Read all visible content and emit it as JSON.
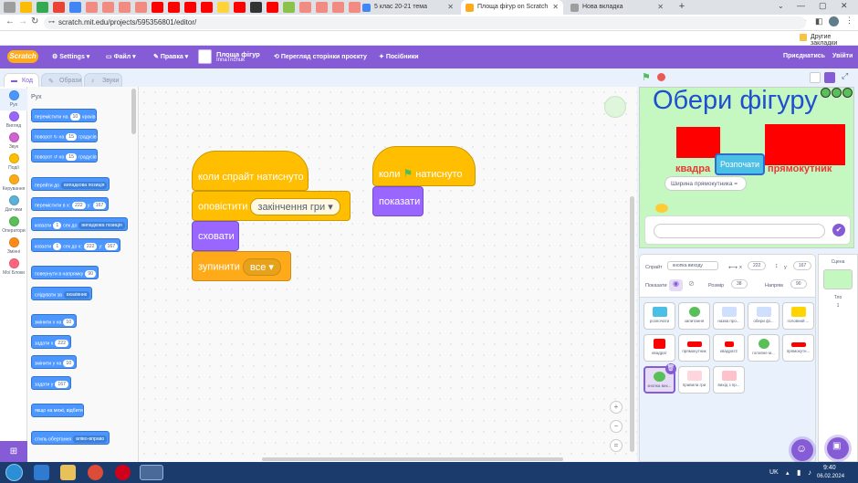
{
  "browser": {
    "tabs": [
      {
        "title": "5 клас 20-21 тема"
      },
      {
        "title": "Площа фігур on Scratch"
      },
      {
        "title": "Нова вкладка"
      }
    ],
    "url": "scratch.mit.edu/projects/595356801/editor/",
    "bookmarks_right": "Другие закладки"
  },
  "menubar": {
    "logo": "Scratch",
    "settings": "Settings",
    "file": "Файл",
    "edit": "Правка",
    "project_title": "Площа фігур",
    "author": "InnaTrichuk",
    "see_project": "Перегляд сторінки проєкту",
    "tutorials": "Посібники",
    "share": "Приєднатись",
    "signin": "Увійти"
  },
  "editor_tabs": {
    "code": "Код",
    "costumes": "Образи",
    "sounds": "Звуки"
  },
  "categories": [
    {
      "label": "Рух",
      "color": "#4c97ff"
    },
    {
      "label": "Вигляд",
      "color": "#9966ff"
    },
    {
      "label": "Звук",
      "color": "#cf63cf"
    },
    {
      "label": "Події",
      "color": "#ffbf00"
    },
    {
      "label": "Керування",
      "color": "#ffab19"
    },
    {
      "label": "Датчики",
      "color": "#5cb1d6"
    },
    {
      "label": "Оператори",
      "color": "#59c059"
    },
    {
      "label": "Змінні",
      "color": "#ff8c1a"
    },
    {
      "label": "Мої Блоки",
      "color": "#ff6680"
    }
  ],
  "palette": {
    "heading": "Рух",
    "blocks": [
      {
        "pre": "перемістити на",
        "v1": "10",
        "post": "кроків"
      },
      {
        "pre": "поворот ↻ на",
        "v1": "15",
        "post": "градусів"
      },
      {
        "pre": "поворот ↺ на",
        "v1": "15",
        "post": "градусів"
      },
      {
        "pre": "перейти до",
        "dd": "випадкова позиція"
      },
      {
        "pre": "перемістити в x:",
        "v1": "222",
        "mid": "y:",
        "v2": "167"
      },
      {
        "pre": "ковзати",
        "v1": "1",
        "mid": "сек до",
        "dd": "випадкова позиція"
      },
      {
        "pre": "ковзати",
        "v1": "1",
        "mid": "сек до x:",
        "v2": "222",
        "mid2": "y:",
        "v3": "167"
      },
      {
        "pre": "повернути в напрямку",
        "v1": "90"
      },
      {
        "pre": "слідувати за",
        "dd": "вказівник"
      },
      {
        "pre": "змінити x на",
        "v1": "10"
      },
      {
        "pre": "задати x",
        "v1": "222"
      },
      {
        "pre": "змінити y на",
        "v1": "10"
      },
      {
        "pre": "задати y",
        "v1": "167"
      },
      {
        "pre": "якщо на межі, відбити"
      },
      {
        "pre": "стиль обертання",
        "dd": "вліво-вправо"
      }
    ]
  },
  "scripts": {
    "s1_hat": "коли спрайт натиснуто",
    "s1_broadcast": "оповістити",
    "s1_broadcast_msg": "закінчення гри",
    "s1_hide": "сховати",
    "s1_stop": "зупинити",
    "s1_stop_opt": "все",
    "s2_hat_pre": "коли",
    "s2_hat_post": "натиснуто",
    "s2_show": "показати"
  },
  "stage": {
    "title": "Обери фігуру",
    "left_label": "квадра",
    "button": "Розпочати",
    "right_label": "прямокутник",
    "speech": "Ширина прямокутника ="
  },
  "sprite_info": {
    "sprite_label": "Спрайт",
    "sprite_name": "кнопка виходу",
    "x_label": "x",
    "x": "222",
    "y_label": "y",
    "y": "167",
    "show_label": "Показати",
    "size_label": "Розмір",
    "size": "38",
    "direction_label": "Напрям",
    "direction": "90"
  },
  "sprites": [
    {
      "name": "розпочати",
      "color": "#4cbfe6"
    },
    {
      "name": "запитання",
      "color": "#59c059"
    },
    {
      "name": "назва про...",
      "color": "#4c97ff"
    },
    {
      "name": "обери фі...",
      "color": "#4c97ff"
    },
    {
      "name": "головний ...",
      "color": "#ffd500"
    },
    {
      "name": "квадрат",
      "color": "#ff0000"
    },
    {
      "name": "прямокутник",
      "color": "#ff0000"
    },
    {
      "name": "квадрат2",
      "color": "#ff0000"
    },
    {
      "name": "головне м...",
      "color": "#59c059"
    },
    {
      "name": "прямокутн...",
      "color": "#ff0000"
    },
    {
      "name": "кнопка вих...",
      "color": "#59c059"
    },
    {
      "name": "правила гри",
      "color": "#ff6680"
    },
    {
      "name": "вихід з пр...",
      "color": "#ff3355"
    }
  ],
  "stage_panel": {
    "label": "Сцена",
    "backdrops_label": "Тло",
    "backdrops": "1"
  },
  "taskbar": {
    "lang": "UK",
    "time": "9:40",
    "date": "06.02.2024"
  }
}
